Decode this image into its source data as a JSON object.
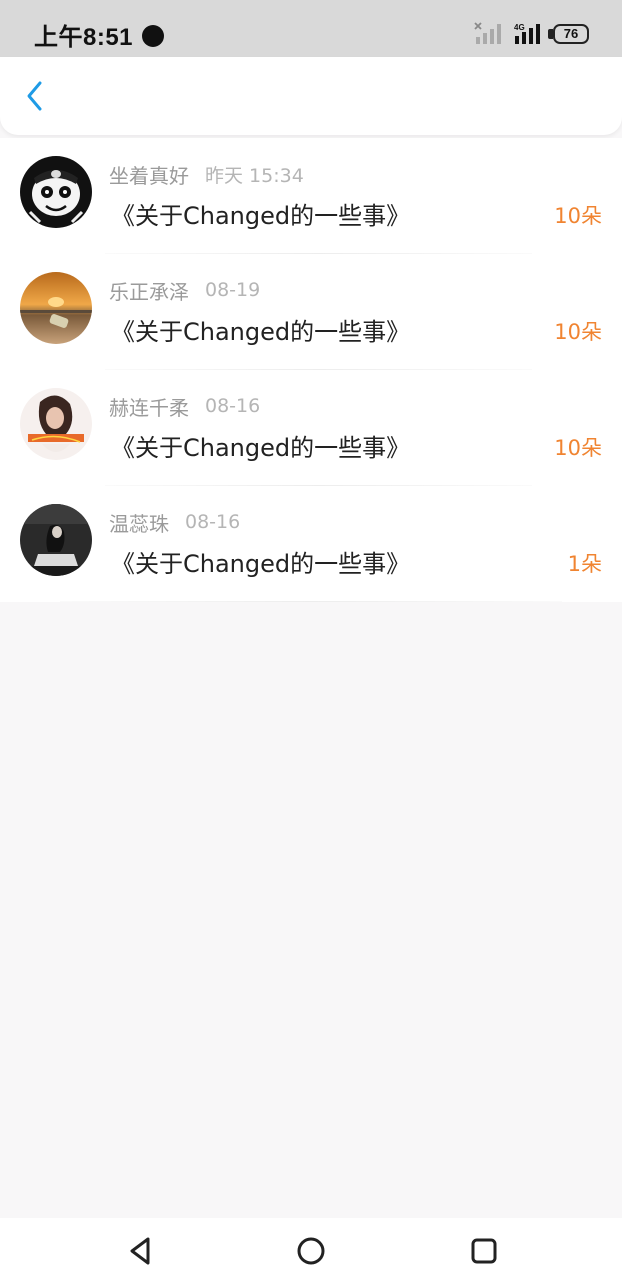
{
  "status_bar": {
    "time": "上午8:51",
    "battery": "76",
    "icons": [
      "chat-bubble-icon",
      "signal-x-icon",
      "signal-4g-icon",
      "battery-icon"
    ]
  },
  "header": {
    "back_icon": "chevron-left-icon"
  },
  "list": {
    "items": [
      {
        "name": "坐着真好",
        "time": "昨天 15:34",
        "title": "《关于Changed的一些事》",
        "count": "10朵",
        "avatar": "cartoon-mask"
      },
      {
        "name": "乐正承泽",
        "time": "08-19",
        "title": "《关于Changed的一些事》",
        "count": "10朵",
        "avatar": "sunset-beach"
      },
      {
        "name": "赫连千柔",
        "time": "08-16",
        "title": "《关于Changed的一些事》",
        "count": "10朵",
        "avatar": "girl-portrait"
      },
      {
        "name": "温蕊珠",
        "time": "08-16",
        "title": "《关于Changed的一些事》",
        "count": "1朵",
        "avatar": "dark-photo"
      }
    ]
  },
  "colors": {
    "accent": "#1e9be6",
    "count": "#f08431",
    "name": "#9a9a9a",
    "title": "#222222",
    "background": "#f8f7f8"
  },
  "nav_bar": {
    "buttons": [
      "back-triangle-icon",
      "home-circle-icon",
      "recents-square-icon"
    ]
  }
}
